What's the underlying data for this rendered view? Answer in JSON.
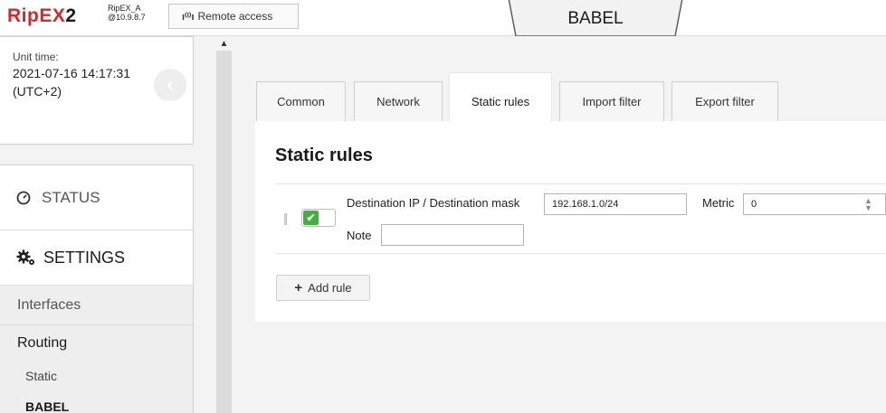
{
  "header": {
    "logo_main": "RipEX",
    "logo_num": "2",
    "unit_name": "RipEX_A",
    "unit_ip": "@10.9.8.7",
    "remote_access_label": "Remote access",
    "remote_access_icon": "antenna-icon",
    "page_tab": "BABEL"
  },
  "sidebar": {
    "unit_time_label": "Unit time:",
    "unit_time_value": "2021-07-16 14:17:31",
    "unit_time_tz": "(UTC+2)",
    "status_label": "STATUS",
    "settings_label": "SETTINGS",
    "interfaces_label": "Interfaces",
    "routing_label": "Routing",
    "routing_items": [
      {
        "label": "Static",
        "active": false
      },
      {
        "label": "BABEL",
        "active": true
      }
    ]
  },
  "tabs": [
    {
      "label": "Common",
      "active": false
    },
    {
      "label": "Network",
      "active": false
    },
    {
      "label": "Static rules",
      "active": true
    },
    {
      "label": "Import filter",
      "active": false
    },
    {
      "label": "Export filter",
      "active": false
    }
  ],
  "panel": {
    "title": "Static rules",
    "rule": {
      "enabled": true,
      "dest_label": "Destination IP / Destination mask",
      "dest_value": "192.168.1.0/24",
      "metric_label": "Metric",
      "metric_value": "0",
      "note_label": "Note",
      "note_value": ""
    },
    "add_rule_label": "Add rule"
  },
  "colors": {
    "brand_red": "#d8262b",
    "toggle_green": "#3db33d"
  }
}
